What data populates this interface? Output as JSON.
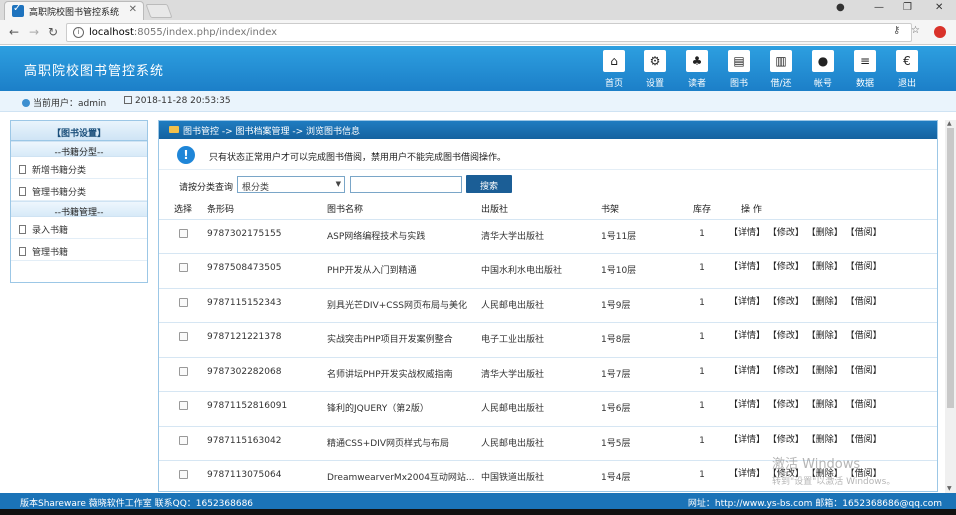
{
  "browser": {
    "tab_title": "高职院校图书管控系统",
    "url_host": "localhost",
    "url_path": ":8055/index.php/index/index"
  },
  "header": {
    "title": "高职院校图书管控系统",
    "menu": [
      {
        "label": "首页",
        "icon": "home-icon"
      },
      {
        "label": "设置",
        "icon": "gear-icon"
      },
      {
        "label": "读者",
        "icon": "users-icon"
      },
      {
        "label": "图书",
        "icon": "book-icon"
      },
      {
        "label": "借/还",
        "icon": "borrow-icon"
      },
      {
        "label": "帐号",
        "icon": "account-icon"
      },
      {
        "label": "数据",
        "icon": "database-icon"
      },
      {
        "label": "退出",
        "icon": "exit-icon"
      }
    ]
  },
  "infobar": {
    "user": "当前用户：admin",
    "time": "2018-11-28 20:53:35"
  },
  "sidebar": {
    "head": "【图书设置】",
    "group1": "--书籍分型--",
    "group1_items": [
      "新增书籍分类",
      "管理书籍分类"
    ],
    "group2": "--书籍管理--",
    "group2_items": [
      "录入书籍",
      "管理书籍"
    ]
  },
  "main": {
    "breadcrumb": "图书管控 -> 图书档案管理 -> 浏览图书信息",
    "notice": "只有状态正常用户才可以完成图书借阅，禁用用户不能完成图书借阅操作。",
    "search_label": "请按分类查询",
    "search_select": "根分类",
    "search_button": "搜索",
    "columns": [
      "选择",
      "条形码",
      "图书名称",
      "出版社",
      "书架",
      "库存",
      "操 作"
    ],
    "ops": [
      "【详情】",
      "【修改】",
      "【删除】",
      "【借阅】"
    ],
    "rows": [
      {
        "barcode": "9787302175155",
        "name": "ASP网络编程技术与实践",
        "publisher": "清华大学出版社",
        "shelf": "1号11层",
        "stock": "1"
      },
      {
        "barcode": "9787508473505",
        "name": "PHP开发从入门到精通",
        "publisher": "中国水利水电出版社",
        "shelf": "1号10层",
        "stock": "1"
      },
      {
        "barcode": "9787115152343",
        "name": "别具光芒DIV+CSS网页布局与美化",
        "publisher": "人民邮电出版社",
        "shelf": "1号9层",
        "stock": "1"
      },
      {
        "barcode": "9787121221378",
        "name": "实战突击PHP项目开发案例整合",
        "publisher": "电子工业出版社",
        "shelf": "1号8层",
        "stock": "1"
      },
      {
        "barcode": "9787302282068",
        "name": "名师讲坛PHP开发实战权威指南",
        "publisher": "清华大学出版社",
        "shelf": "1号7层",
        "stock": "1"
      },
      {
        "barcode": "9787115281609​1",
        "name": "锋利的JQUERY（第2版）",
        "publisher": "人民邮电出版社",
        "shelf": "1号6层",
        "stock": "1"
      },
      {
        "barcode": "9787115163042",
        "name": "精通CSS+DIV网页样式与布局",
        "publisher": "人民邮电出版社",
        "shelf": "1号5层",
        "stock": "1"
      },
      {
        "barcode": "9787113075064",
        "name": "DreamwearverMx2004互动网站...",
        "publisher": "中国铁道出版社",
        "shelf": "1号4层",
        "stock": "1"
      }
    ]
  },
  "footer": {
    "left": "版本Shareware  薇晓软件工作室  联系QQ：1652368686",
    "right": "网址：http://www.ys-bs.com  邮箱：1652368686@qq.com"
  },
  "watermark": {
    "line1": "激活 Windows",
    "line2": "转到\"设置\"以激活 Windows。"
  }
}
